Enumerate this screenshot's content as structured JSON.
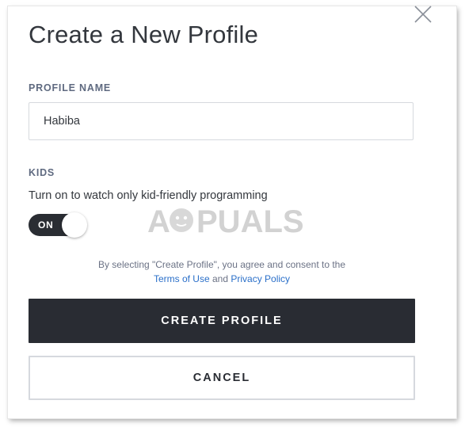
{
  "dialog": {
    "title": "Create a New Profile",
    "close_icon": "close-icon"
  },
  "profile_name": {
    "label": "PROFILE NAME",
    "value": "Habiba",
    "placeholder": ""
  },
  "kids": {
    "label": "KIDS",
    "description": "Turn on to watch only kid-friendly programming",
    "toggle_label": "ON",
    "toggle_state": true
  },
  "consent": {
    "text": "By selecting \"Create Profile\", you agree and consent to the",
    "terms_link": "Terms of Use",
    "conjunction": "and",
    "privacy_link": "Privacy Policy"
  },
  "buttons": {
    "create_label": "CREATE PROFILE",
    "cancel_label": "CANCEL"
  },
  "watermark": {
    "text": "APPUALS"
  },
  "colors": {
    "primary_dark": "#292c33",
    "link": "#2a6fc9",
    "label_gray": "#5f6a80",
    "border": "#d6d9de"
  }
}
